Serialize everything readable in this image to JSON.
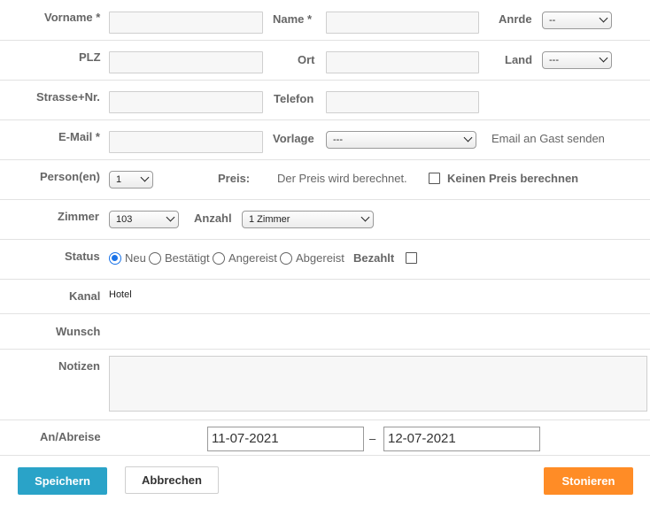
{
  "row1": {
    "firstname_label": "Vorname *",
    "firstname_value": "",
    "name_label": "Name *",
    "name_value": "",
    "salutation_label": "Anrde",
    "salutation_value": "--"
  },
  "row2": {
    "zip_label": "PLZ",
    "zip_value": "",
    "city_label": "Ort",
    "city_value": "",
    "country_label": "Land",
    "country_value": "---"
  },
  "row3": {
    "street_label": "Strasse+Nr.",
    "street_value": "",
    "phone_label": "Telefon",
    "phone_value": ""
  },
  "row4": {
    "email_label": "E-Mail *",
    "email_value": "",
    "template_label": "Vorlage",
    "template_value": "---",
    "send_email_text": "Email an Gast senden"
  },
  "row5": {
    "persons_label": "Person(en)",
    "persons_value": "1",
    "price_label": "Preis:",
    "price_text": "Der Preis wird berechnet.",
    "no_price_label": "Keinen Preis berechnen"
  },
  "row6": {
    "room_label": "Zimmer",
    "room_value": "103",
    "count_label": "Anzahl",
    "count_value": "1 Zimmer"
  },
  "row7": {
    "status_label": "Status",
    "options": [
      "Neu",
      "Bestätigt",
      "Angereist",
      "Abgereist"
    ],
    "selected": "Neu",
    "paid_label": "Bezahlt"
  },
  "row8": {
    "channel_label": "Kanal",
    "channel_value": "Hotel"
  },
  "row9": {
    "wish_label": "Wunsch"
  },
  "row10": {
    "notes_label": "Notizen",
    "notes_value": ""
  },
  "row11": {
    "dates_label": "An/Abreise",
    "arrival": "11-07-2021",
    "separator": "–",
    "departure": "12-07-2021"
  },
  "buttons": {
    "save": "Speichern",
    "cancel": "Abbrechen",
    "cancel_booking": "Stonieren"
  },
  "colors": {
    "save": "#2aa3c8",
    "storno": "#ff8c26",
    "radio_on": "#1a73e8"
  }
}
